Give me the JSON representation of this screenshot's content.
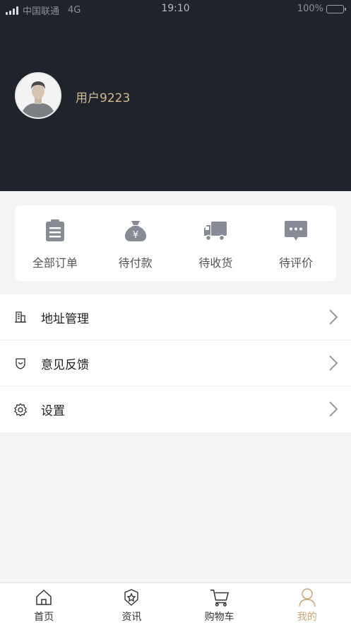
{
  "status_bar": {
    "carrier": "中国联通",
    "network": "4G",
    "time": "19:10",
    "battery": "100%"
  },
  "profile": {
    "username": "用户9223"
  },
  "orders": [
    {
      "label": "全部订单",
      "icon": "clipboard-icon"
    },
    {
      "label": "待付款",
      "icon": "money-bag-icon"
    },
    {
      "label": "待收货",
      "icon": "truck-icon"
    },
    {
      "label": "待评价",
      "icon": "chat-bubble-icon"
    }
  ],
  "menu": [
    {
      "label": "地址管理",
      "icon": "building-icon"
    },
    {
      "label": "意见反馈",
      "icon": "feedback-icon"
    },
    {
      "label": "设置",
      "icon": "gear-icon"
    }
  ],
  "tabbar": [
    {
      "label": "首页",
      "icon": "home-icon",
      "active": false
    },
    {
      "label": "资讯",
      "icon": "news-badge-icon",
      "active": false
    },
    {
      "label": "购物车",
      "icon": "cart-icon",
      "active": false
    },
    {
      "label": "我的",
      "icon": "user-icon",
      "active": true
    }
  ],
  "colors": {
    "header_bg": "#1f232b",
    "accent_gold": "#c9a777",
    "username": "#d4b98f",
    "icon_gray": "#868b95"
  }
}
